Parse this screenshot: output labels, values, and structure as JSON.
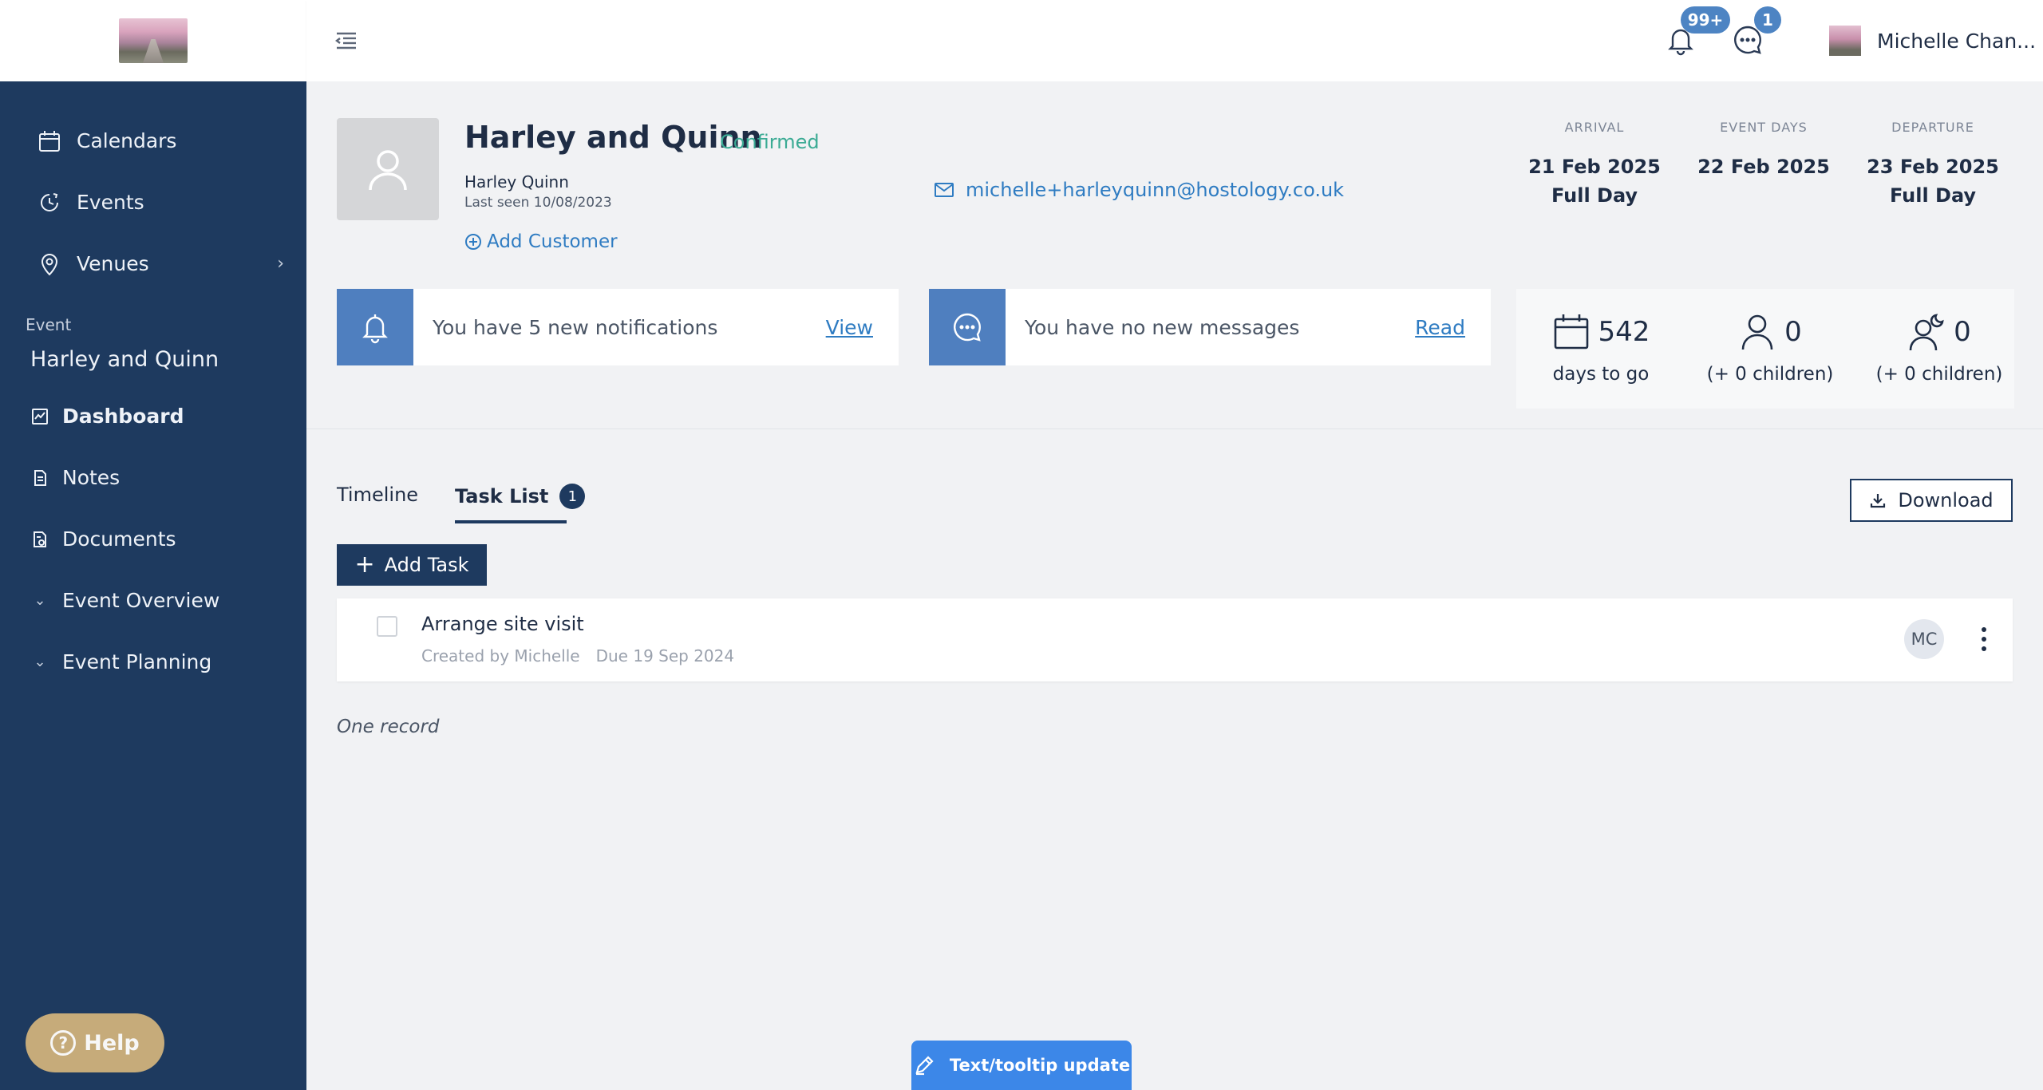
{
  "sidebar": {
    "nav": [
      {
        "label": "Calendars",
        "icon": "calendar-icon"
      },
      {
        "label": "Events",
        "icon": "events-icon"
      },
      {
        "label": "Venues",
        "icon": "location-pin-icon"
      }
    ],
    "section_label": "Event",
    "event_name": "Harley and Quinn",
    "sub_items": [
      {
        "label": "Dashboard",
        "icon": "chart-icon"
      },
      {
        "label": "Notes",
        "icon": "note-icon"
      },
      {
        "label": "Documents",
        "icon": "document-icon"
      },
      {
        "label": "Event Overview",
        "icon": "chevron-down-icon"
      },
      {
        "label": "Event Planning",
        "icon": "chevron-down-icon"
      }
    ],
    "help_label": "Help"
  },
  "topbar": {
    "notifications_badge": "99+",
    "messages_badge": "1",
    "user_name": "Michelle Chan..."
  },
  "event": {
    "title": "Harley and Quinn",
    "status": "Confirmed",
    "customer_name": "Harley Quinn",
    "last_seen": "Last seen 10/08/2023",
    "add_customer": "Add Customer",
    "email": "michelle+harleyquinn@hostology.co.uk"
  },
  "dates": {
    "arrival_label": "ARRIVAL",
    "arrival_date": "21 Feb 2025",
    "arrival_note": "Full Day",
    "event_days_label": "EVENT DAYS",
    "event_days_date": "22 Feb 2025",
    "departure_label": "DEPARTURE",
    "departure_date": "23 Feb 2025",
    "departure_note": "Full Day"
  },
  "cards": {
    "notifications_text": "You have 5 new notifications",
    "notifications_link": "View",
    "messages_text": "You have no new messages",
    "messages_link": "Read"
  },
  "stats": {
    "days_value": "542",
    "days_caption": "days to go",
    "guests_value": "0",
    "guests_caption": "(+ 0 children)",
    "overnight_value": "0",
    "overnight_caption": "(+ 0 children)"
  },
  "tabs": {
    "timeline": "Timeline",
    "task_list": "Task List",
    "task_count": "1"
  },
  "actions": {
    "download": "Download",
    "add_task": "Add Task"
  },
  "tasks": [
    {
      "title": "Arrange site visit",
      "created_by": "Created by Michelle",
      "due": "Due 19 Sep 2024",
      "assignee": "MC"
    }
  ],
  "record_count": "One record",
  "update_tag": "Text/tooltip update"
}
